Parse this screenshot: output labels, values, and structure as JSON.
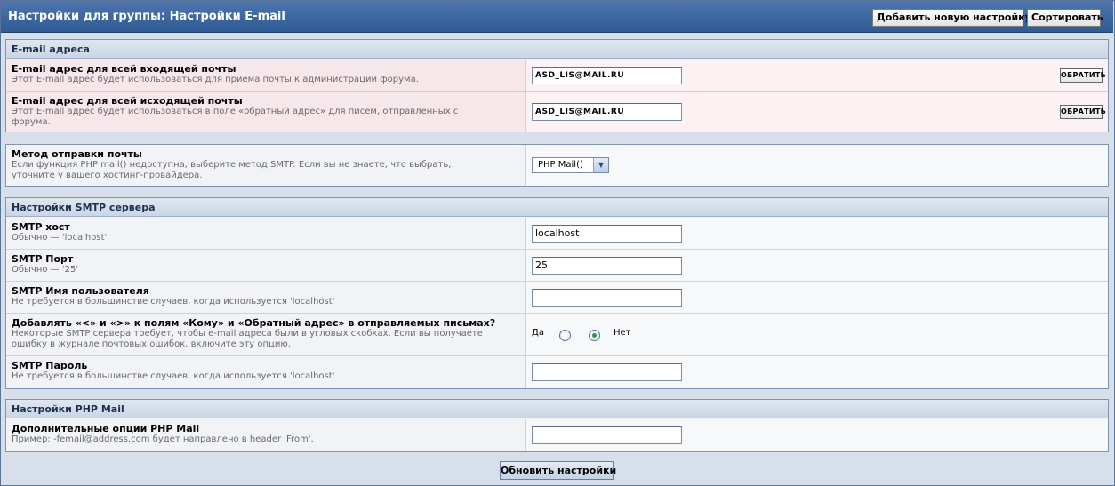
{
  "header": {
    "title": "Настройки для группы: Настройки E-mail",
    "add_button": "Добавить новую настройку",
    "sort_button": "Сортировать"
  },
  "sections": {
    "email": {
      "title": "E-mail адреса",
      "incoming": {
        "title": "E-mail адрес для всей входящей почты",
        "desc": "Этот E-mail адрес будет использоваться для приема почты к администрации форума.",
        "value": "ASD_LIS@MAIL.RU",
        "button": "ОБРАТИТЬ"
      },
      "outgoing": {
        "title": "E-mail адрес для всей исходящей почты",
        "desc": "Этот E-mail адрес будет использоваться в поле «обратный адрес» для писем, отправленных с форума.",
        "value": "ASD_LIS@MAIL.RU",
        "button": "ОБРАТИТЬ"
      }
    },
    "method": {
      "title": "Метод отправки почты",
      "desc": "Если функция PHP mail() недоступна, выберите метод SMTP. Если вы не знаете, что выбрать, уточните у вашего хостинг-провайдера.",
      "selected": "PHP Mail()"
    },
    "smtp": {
      "title": "Настройки SMTP сервера",
      "host": {
        "title": "SMTP хост",
        "desc": "Обычно — 'localhost'",
        "value": "localhost"
      },
      "port": {
        "title": "SMTP Порт",
        "desc": "Обычно — '25'",
        "value": "25"
      },
      "user": {
        "title": "SMTP Имя пользователя",
        "desc": "Не требуется в большинстве случаев, когда используется 'localhost'",
        "value": ""
      },
      "brackets": {
        "title": "Добавлять «<» и «>» к полям «Кому» и «Обратный адрес» в отправляемых письмах?",
        "desc": "Некоторые SMTP сервера требует, чтобы e-mail адреса были в угловых скобках. Если вы получаете ошибку в журнале почтовых ошибок, включите эту опцию.",
        "yes_label": "Да",
        "no_label": "Нет",
        "selected": "no"
      },
      "password": {
        "title": "SMTP Пароль",
        "desc": "Не требуется в большинстве случаев, когда используется 'localhost'",
        "value": ""
      }
    },
    "phpmail": {
      "title": "Настройки PHP Mail",
      "options": {
        "title": "Дополнительные опции PHP Mail",
        "desc": "Пример: -femail@address.com будет направлено в header 'From'.",
        "value": ""
      }
    }
  },
  "footer": {
    "submit_button": "Обновить настройки"
  },
  "colors": {
    "header_bg": "#3a66a0",
    "highlight_row": "#f5e7ea",
    "radio_checked": "#2a9b3a"
  }
}
